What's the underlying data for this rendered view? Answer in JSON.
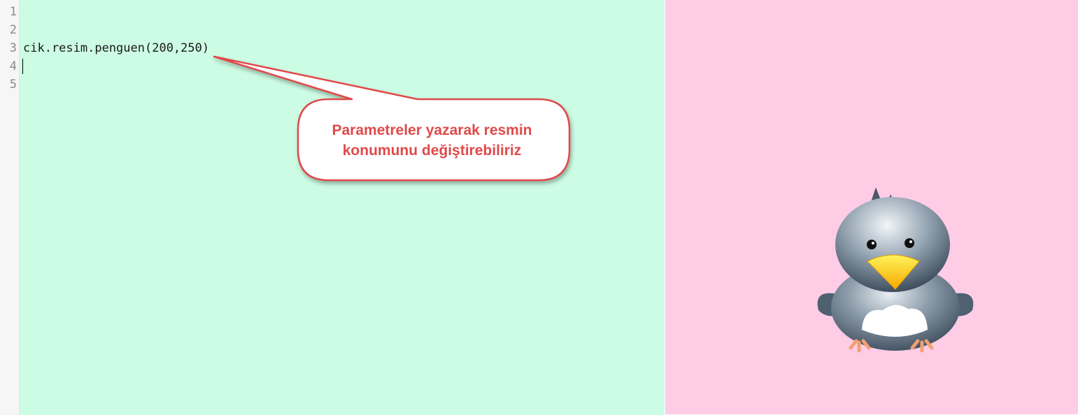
{
  "editor": {
    "line_numbers": [
      "1",
      "2",
      "3",
      "4",
      "5"
    ],
    "lines": [
      "",
      "",
      "cik.resim.penguen(200,250)",
      "",
      ""
    ]
  },
  "callout": {
    "text_line1": "Parametreler yazarak resmin",
    "text_line2": "konumunu değiştirebiliriz",
    "color": "#e04a4a"
  },
  "colors": {
    "editor_bg": "#ccfce4",
    "stage_bg": "#ffcce6",
    "gutter_bg": "#f6f6f6"
  },
  "stage": {
    "image": "penguin-bird-icon"
  }
}
